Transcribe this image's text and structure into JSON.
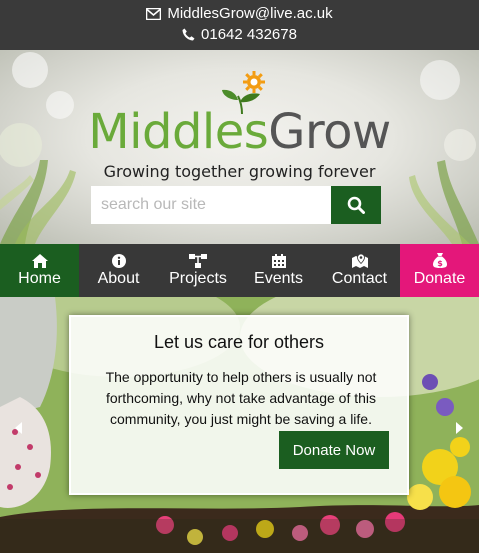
{
  "contact": {
    "email": "MiddlesGrow@live.ac.uk",
    "phone": "01642 432678"
  },
  "branding": {
    "name_part1": "Middles",
    "name_part2": "Grow",
    "tagline": "Growing together growing forever",
    "colors": {
      "green": "#6aaa3a",
      "grey": "#555555",
      "flower": "#f39c12"
    }
  },
  "search": {
    "placeholder": "search our site",
    "button_icon": "search-icon"
  },
  "nav": {
    "items": [
      {
        "label": "Home",
        "icon": "home-icon"
      },
      {
        "label": "About",
        "icon": "info-icon"
      },
      {
        "label": "Projects",
        "icon": "sitemap-icon"
      },
      {
        "label": "Events",
        "icon": "calendar-icon"
      },
      {
        "label": "Contact",
        "icon": "map-pin-icon"
      },
      {
        "label": "Donate",
        "icon": "money-bag-icon"
      }
    ],
    "colors": {
      "active": "#1b5e20",
      "donate": "#e4177a",
      "bar": "#383838"
    }
  },
  "slide": {
    "title": "Let us care for others",
    "body": "The opportunity to help others is usually not forthcoming, why not take advantage of this community, you just might be saving a life.",
    "cta": "Donate Now"
  }
}
